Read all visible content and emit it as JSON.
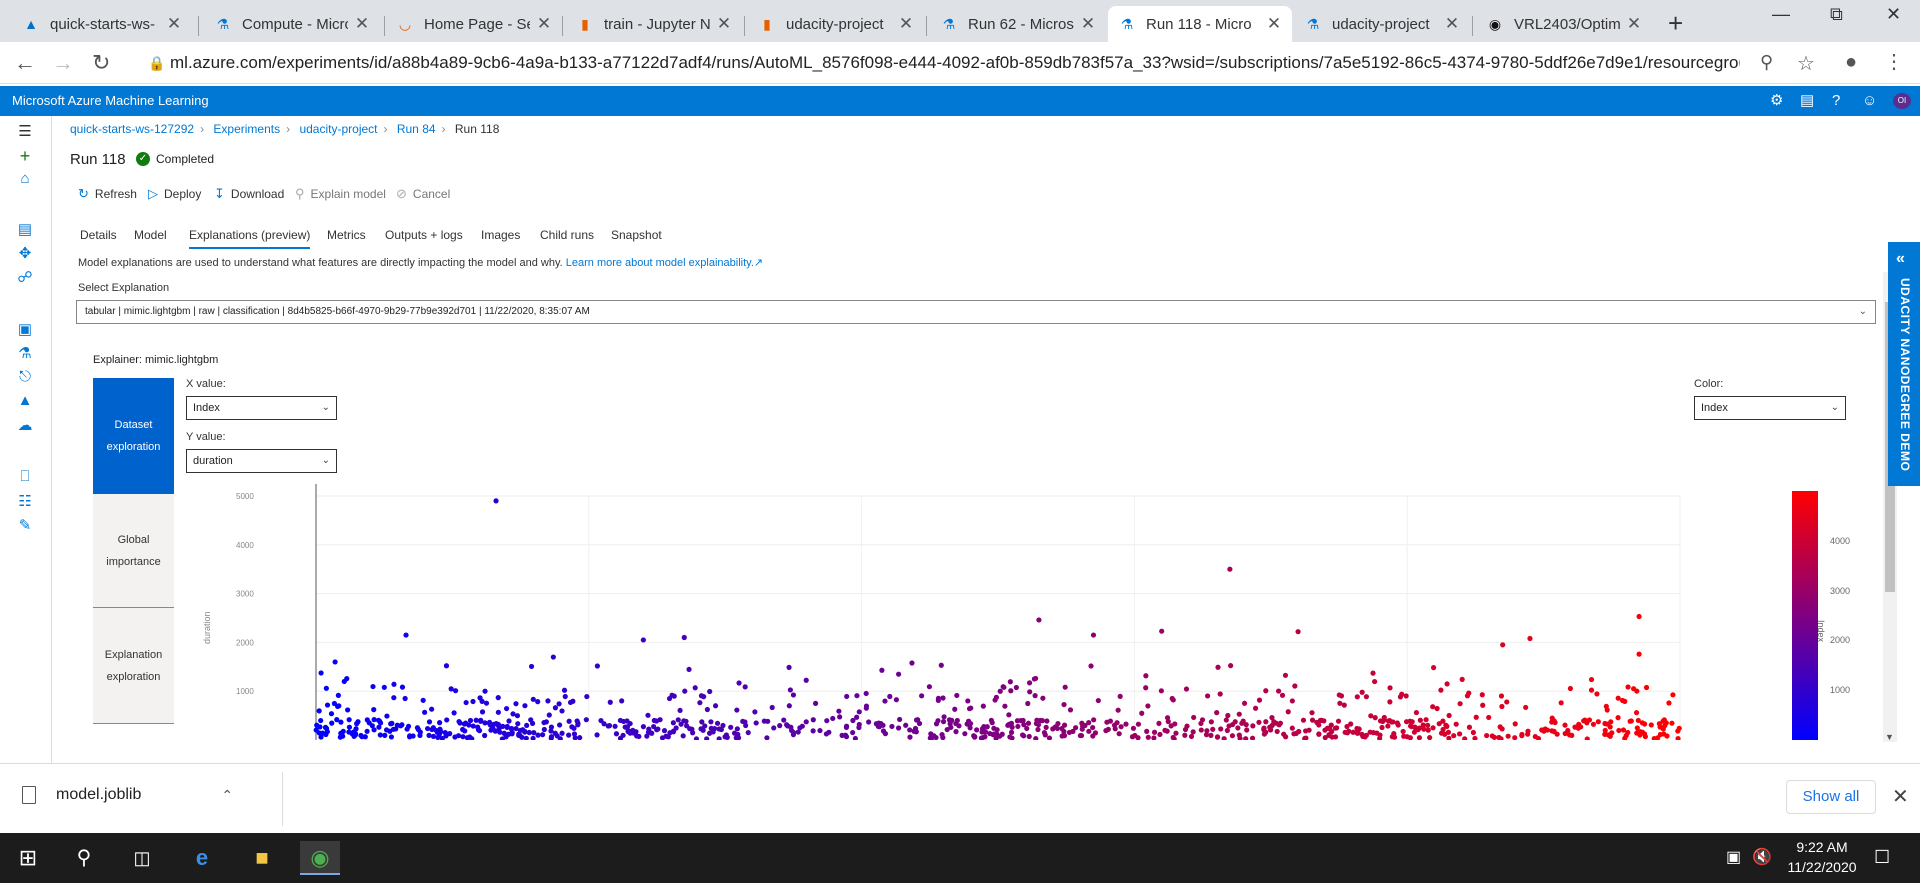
{
  "browser": {
    "tabs": [
      {
        "title": "quick-starts-ws-",
        "icon": "azure-logo-icon"
      },
      {
        "title": "Compute - Micro",
        "icon": "flask-icon"
      },
      {
        "title": "Home Page - Sel",
        "icon": "loading-spinner-icon"
      },
      {
        "title": "train - Jupyter N",
        "icon": "notebook-icon"
      },
      {
        "title": "udacity-project",
        "icon": "notebook-icon"
      },
      {
        "title": "Run 62 - Microso",
        "icon": "flask-icon"
      },
      {
        "title": "Run 118 - Micro",
        "icon": "flask-icon"
      },
      {
        "title": "udacity-project",
        "icon": "flask-icon"
      },
      {
        "title": "VRL2403/Optim",
        "icon": "github-icon"
      }
    ],
    "url": "ml.azure.com/experiments/id/a88b4a89-9cb6-4a9a-b133-a77122d7adf4/runs/AutoML_8576f098-e444-4092-af0b-859db783f57a_33?wsid=/subscriptions/7a5e5192-86c5-4374-9780-5ddf26e7d9e1/resourcegrou..."
  },
  "app": {
    "title": "Microsoft Azure Machine Learning",
    "avatar_initials": "OI"
  },
  "breadcrumb": [
    "quick-starts-ws-127292",
    "Experiments",
    "udacity-project",
    "Run 84",
    "Run 118"
  ],
  "run": {
    "title": "Run 118",
    "status": "Completed"
  },
  "commands": {
    "refresh": "Refresh",
    "deploy": "Deploy",
    "download": "Download",
    "explain": "Explain model",
    "cancel": "Cancel"
  },
  "tabs": [
    "Details",
    "Model",
    "Explanations (preview)",
    "Metrics",
    "Outputs + logs",
    "Images",
    "Child runs",
    "Snapshot"
  ],
  "explanations": {
    "description": "Model explanations are used to understand what features are directly impacting the model and why.",
    "learn_more": "Learn more about model explainability.",
    "select_label": "Select Explanation",
    "selected": "tabular | mimic.lightgbm | raw | classification | 8d4b5825-b66f-4970-9b29-77b9e392d701 | 11/22/2020, 8:35:07 AM",
    "explainer_label": "Explainer:",
    "explainer_value": "mimic.lightgbm",
    "views": [
      "Dataset exploration",
      "Global importance",
      "Explanation exploration"
    ],
    "x_label": "X value:",
    "x_value": "Index",
    "y_label": "Y value:",
    "y_value": "duration",
    "color_label": "Color:",
    "color_value": "Index"
  },
  "chart_data": {
    "type": "scatter",
    "x_field": "Index",
    "y_field": "duration",
    "color_field": "Index",
    "ylabel": "duration",
    "yticks": [
      1000,
      2000,
      3000,
      4000,
      5000
    ],
    "xlim": [
      0,
      5000
    ],
    "ylim": [
      0,
      5000
    ],
    "colorbar": {
      "title": "Index",
      "ticks": [
        1000,
        2000,
        3000,
        4000
      ],
      "low_color": "#0000ff",
      "high_color": "#ff0000"
    },
    "notable_points": [
      {
        "x": 660,
        "y": 4900
      },
      {
        "x": 3350,
        "y": 3500
      },
      {
        "x": 4850,
        "y": 2530
      },
      {
        "x": 2650,
        "y": 2460
      },
      {
        "x": 3100,
        "y": 2230
      },
      {
        "x": 3600,
        "y": 2220
      },
      {
        "x": 330,
        "y": 2150
      },
      {
        "x": 1350,
        "y": 2100
      },
      {
        "x": 1200,
        "y": 2050
      },
      {
        "x": 2850,
        "y": 2150
      },
      {
        "x": 4450,
        "y": 2080
      },
      {
        "x": 4350,
        "y": 1950
      },
      {
        "x": 4850,
        "y": 1760
      },
      {
        "x": 70,
        "y": 1600
      },
      {
        "x": 870,
        "y": 1700
      }
    ],
    "bulk": {
      "n": 900,
      "x_range": [
        0,
        5000
      ],
      "y_median": 300
    }
  },
  "udacity_banner": "UDACITY NANODEGREE DEMO",
  "downloads": {
    "file": "model.joblib",
    "show_all": "Show all"
  },
  "taskbar": {
    "time": "9:22 AM",
    "date": "11/22/2020"
  }
}
